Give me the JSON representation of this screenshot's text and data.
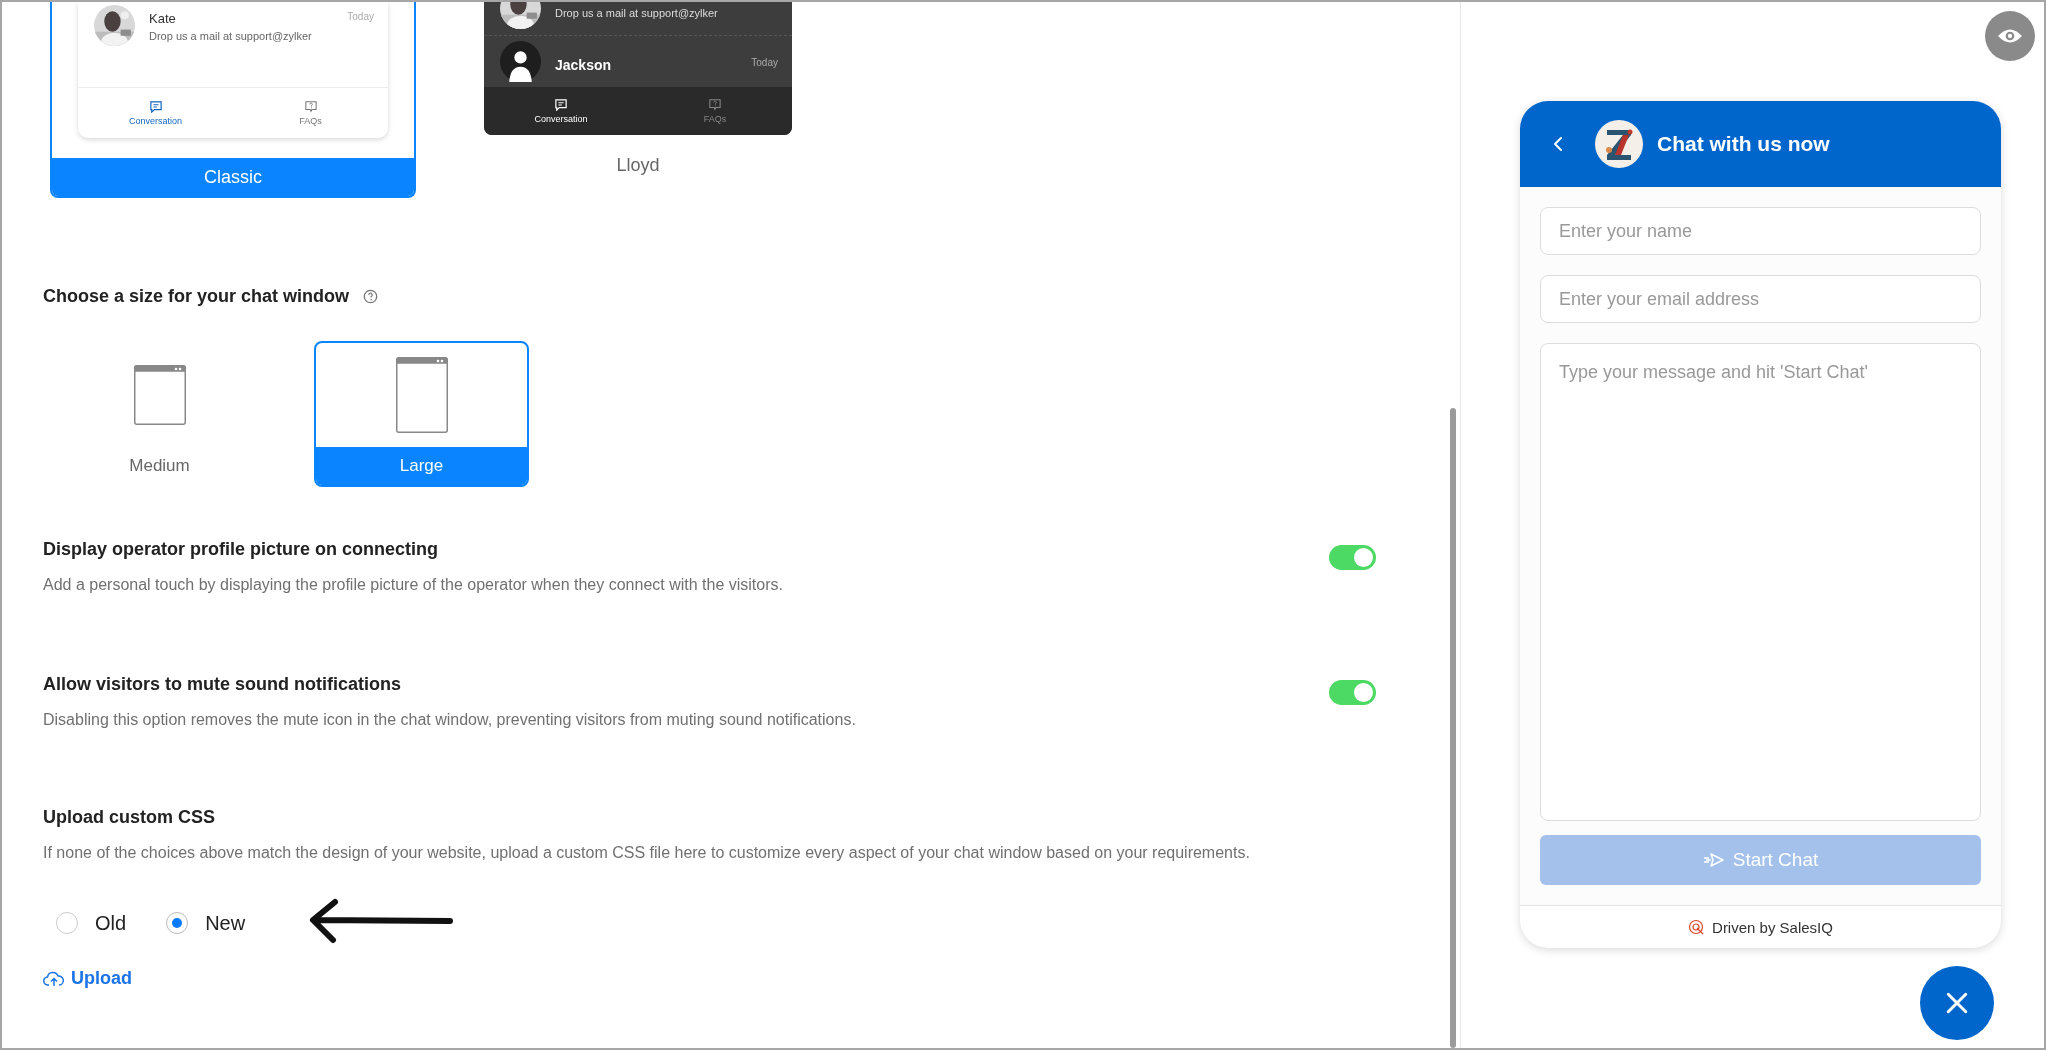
{
  "themes": [
    {
      "name": "Classic",
      "kind": "light",
      "selected": true,
      "rows": [
        {
          "kind": "picture",
          "name": "Kate",
          "time": "Today",
          "message": "Drop us a mail at support@zylker"
        }
      ],
      "tabs": [
        {
          "label": "Conversation",
          "selected": true
        },
        {
          "label": "FAQs",
          "selected": false
        }
      ]
    },
    {
      "name": "Lloyd",
      "kind": "dark",
      "selected": false,
      "rows": [
        {
          "kind": "picture",
          "message": "Drop us a mail at support@zylker"
        },
        {
          "kind": "silhouette",
          "name": "Jackson",
          "time": "Today"
        }
      ],
      "tabs": [
        {
          "label": "Conversation",
          "selected": true
        },
        {
          "label": "FAQs",
          "selected": false
        }
      ]
    }
  ],
  "size": {
    "title": "Choose a size for your chat window",
    "options": [
      {
        "label": "Medium",
        "kind": "medium",
        "selected": false
      },
      {
        "label": "Large",
        "kind": "large",
        "selected": true
      }
    ]
  },
  "settings": [
    {
      "title": "Display operator profile picture on connecting",
      "description": "Add a personal touch by displaying the profile picture of the operator when they connect with the visitors.",
      "on": true
    },
    {
      "title": "Allow visitors to mute sound notifications",
      "description": "Disabling this option removes the mute icon in the chat window, preventing visitors from muting sound notifications.",
      "on": true
    }
  ],
  "custom_css": {
    "title": "Upload custom CSS",
    "description": "If none of the choices above match the design of your website, upload a custom CSS file here to customize every aspect of your chat window based on your requirements.",
    "options": [
      {
        "label": "Old",
        "selected": false
      },
      {
        "label": "New",
        "selected": true
      }
    ],
    "upload": "Upload"
  },
  "chat": {
    "title": "Chat with us now",
    "fields": [
      {
        "kind": "input",
        "placeholder": "Enter your name"
      },
      {
        "kind": "input",
        "placeholder": "Enter your email address"
      },
      {
        "kind": "textarea",
        "placeholder": "Type your message and hit 'Start Chat'"
      }
    ],
    "button": {
      "label": "Start Chat",
      "disabled": true
    },
    "footer": "Driven by SalesIQ"
  }
}
